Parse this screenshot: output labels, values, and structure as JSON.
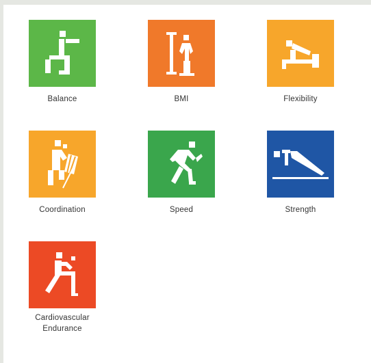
{
  "tiles": [
    {
      "key": "balance",
      "label": "Balance",
      "color": "#5cb748",
      "icon": "balance-figure-icon"
    },
    {
      "key": "bmi",
      "label": "BMI",
      "color": "#f0792a",
      "icon": "height-measure-icon"
    },
    {
      "key": "flexibility",
      "label": "Flexibility",
      "color": "#f7a62b",
      "icon": "sit-and-reach-icon"
    },
    {
      "key": "coordination",
      "label": "Coordination",
      "color": "#f7a62b",
      "icon": "juggling-figure-icon"
    },
    {
      "key": "speed",
      "label": "Speed",
      "color": "#3aa64c",
      "icon": "running-figure-icon"
    },
    {
      "key": "strength",
      "label": "Strength",
      "color": "#1f56a5",
      "icon": "push-up-figure-icon"
    },
    {
      "key": "cardio",
      "label_line1": "Cardiovascular",
      "label_line2": "Endurance",
      "color": "#ec4a25",
      "icon": "step-test-figure-icon"
    }
  ]
}
